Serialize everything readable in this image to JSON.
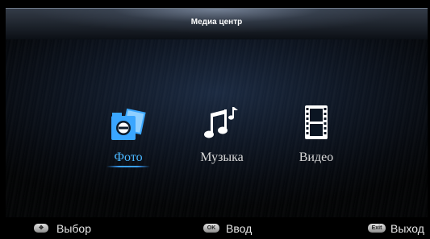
{
  "header": {
    "title": "Медиа центр"
  },
  "menu": {
    "items": [
      {
        "label": "Фото",
        "icon": "camera-photos-icon",
        "selected": true
      },
      {
        "label": "Музыка",
        "icon": "music-note-icon",
        "selected": false
      },
      {
        "label": "Видео",
        "icon": "film-strip-icon",
        "selected": false
      }
    ]
  },
  "footer": {
    "select": {
      "key": "✥",
      "label": "Выбор"
    },
    "enter": {
      "key": "OK",
      "label": "Ввод"
    },
    "exit": {
      "key": "Exit",
      "label": "Выход"
    }
  },
  "colors": {
    "selected": "#4ab6ff",
    "unselected": "#d8d8d8",
    "icon_selected": "#3aa6ff",
    "icon": "#ffffff"
  }
}
